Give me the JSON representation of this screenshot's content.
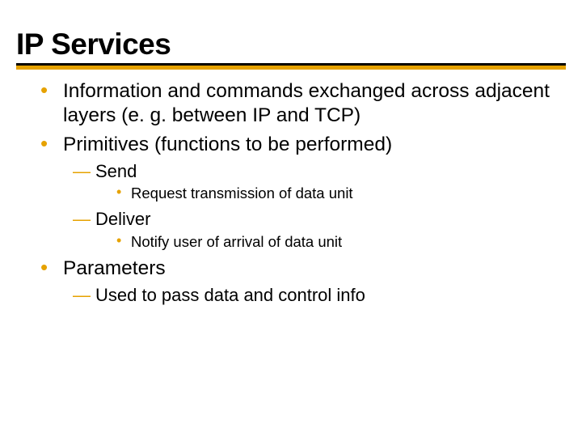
{
  "title": "IP Services",
  "bullets": {
    "b0": "Information and commands exchanged across adjacent layers (e. g. between IP and TCP)",
    "b1": "Primitives (functions to be performed)",
    "b1_sub": {
      "s0": "Send",
      "s0_sub": "Request transmission of data unit",
      "s1": "Deliver",
      "s1_sub": "Notify user of arrival of data unit"
    },
    "b2": "Parameters",
    "b2_sub": {
      "s0": "Used to pass data and control info"
    }
  }
}
